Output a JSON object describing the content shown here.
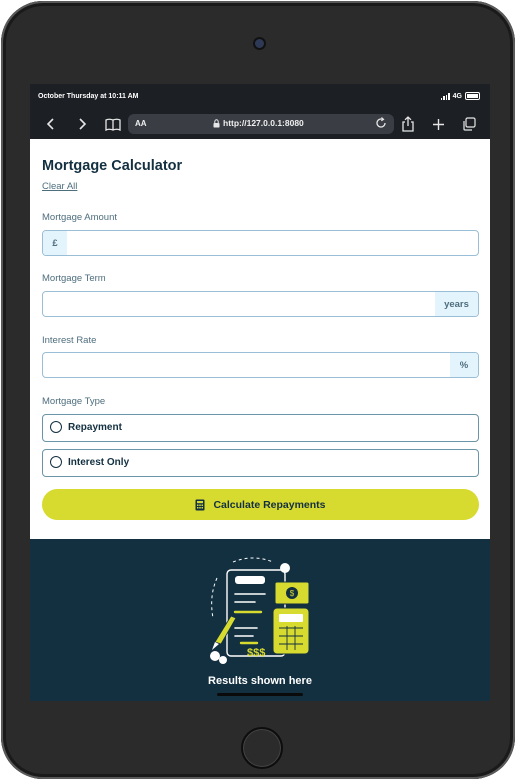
{
  "status_bar": {
    "time": "October Thursday at 10:11 AM",
    "network": "4G"
  },
  "browser": {
    "aa_label": "AA",
    "url": "http://127.0.0.1:8080",
    "icons": [
      "chevron-left-icon",
      "chevron-right-icon",
      "book-icon",
      "lock-icon",
      "reload-icon",
      "share-icon",
      "plus-icon",
      "tabs-icon"
    ]
  },
  "calculator": {
    "title": "Mortgage Calculator",
    "clear_all": "Clear All",
    "amount": {
      "label": "Mortgage Amount",
      "prefix": "£",
      "value": ""
    },
    "term": {
      "label": "Mortgage Term",
      "suffix": "years",
      "value": ""
    },
    "rate": {
      "label": "Interest Rate",
      "suffix": "%",
      "value": ""
    },
    "type": {
      "label": "Mortgage Type",
      "options": [
        {
          "label": "Repayment",
          "selected": false
        },
        {
          "label": "Interest Only",
          "selected": false
        }
      ]
    },
    "submit_label": "Calculate Repayments"
  },
  "results": {
    "empty_title": "Results shown here"
  },
  "colors": {
    "slate_900": "#133041",
    "slate_700": "#4e6e7e",
    "lime": "#d7da2f",
    "affix_bg": "#e4f4fd",
    "border": "#9abed5"
  }
}
